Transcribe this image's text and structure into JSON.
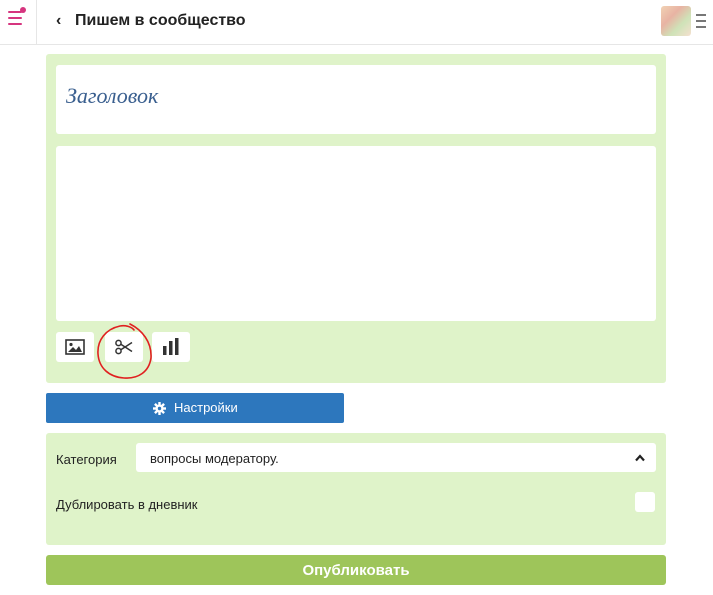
{
  "header": {
    "back_glyph": "‹",
    "title": "Пишем в сообщество",
    "menu_icon": "hamburger-menu-icon",
    "kebab_icon": "vertical-menu-icon"
  },
  "editor": {
    "title_placeholder": "Заголовок",
    "body_text": "",
    "tools": [
      {
        "name": "image-insert",
        "icon": "image-icon"
      },
      {
        "name": "cut",
        "icon": "scissors-icon"
      },
      {
        "name": "poll",
        "icon": "bar-chart-icon"
      }
    ]
  },
  "settings": {
    "label": "Настройки",
    "icon": "gear-icon"
  },
  "options": {
    "category_label": "Категория",
    "category_value": "вопросы модератору.",
    "duplicate_label": "Дублировать в дневник",
    "duplicate_checked": false
  },
  "publish": {
    "label": "Опубликовать"
  },
  "colors": {
    "accent_pink": "#d6357f",
    "panel_green": "#dff3c9",
    "settings_blue": "#2d77bd",
    "publish_green": "#9ec55a",
    "title_blue": "#3a5f8f",
    "annotation_red": "#e02020"
  }
}
